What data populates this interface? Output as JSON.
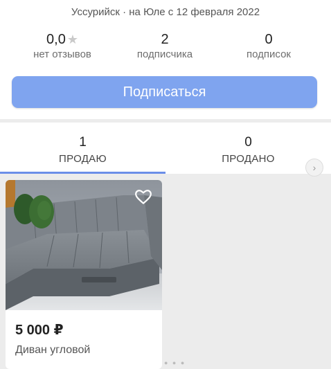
{
  "profile": {
    "location_line": "Уссурийск · на Юле с 12 февраля 2022",
    "stats": {
      "reviews": {
        "value": "0,0",
        "label": "нет отзывов"
      },
      "followers": {
        "value": "2",
        "label": "подписчика"
      },
      "following": {
        "value": "0",
        "label": "подписок"
      }
    },
    "subscribe_label": "Подписаться"
  },
  "tabs": [
    {
      "count": "1",
      "label": "ПРОДАЮ",
      "active": true
    },
    {
      "count": "0",
      "label": "ПРОДАНО",
      "active": false
    }
  ],
  "listing": {
    "price": "5 000 ₽",
    "title": "Диван угловой",
    "image_subject": "grey corner sofa with green pillows"
  },
  "icons": {
    "rating": "star-icon",
    "favorite": "heart-icon",
    "scroll": "chevron-right-icon"
  },
  "colors": {
    "accent": "#7fa4ef",
    "tab_indicator": "#6b8ee8",
    "background": "#ececec"
  }
}
